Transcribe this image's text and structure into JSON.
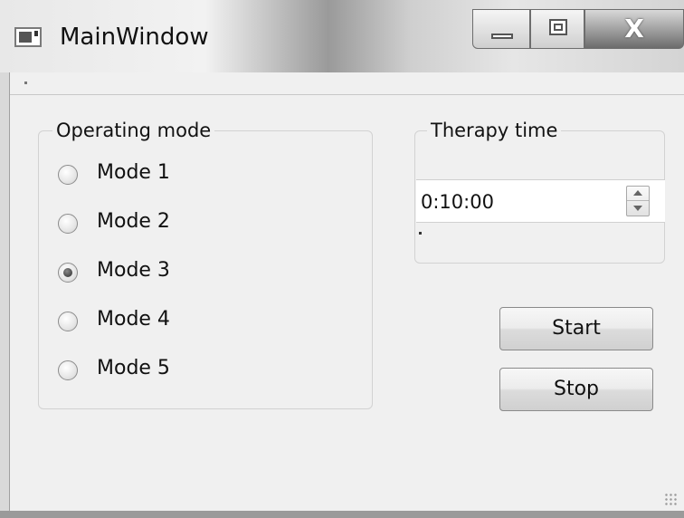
{
  "window": {
    "title": "MainWindow",
    "controls": {
      "minimize": "minimize",
      "maximize": "maximize",
      "close_glyph": "X"
    }
  },
  "operating_mode": {
    "title": "Operating mode",
    "options": [
      {
        "label": "Mode 1",
        "checked": false
      },
      {
        "label": "Mode 2",
        "checked": false
      },
      {
        "label": "Mode 3",
        "checked": true
      },
      {
        "label": "Mode 4",
        "checked": false
      },
      {
        "label": "Mode 5",
        "checked": false
      }
    ]
  },
  "therapy_time": {
    "title": "Therapy time",
    "value": "0:10:00"
  },
  "buttons": {
    "start": "Start",
    "stop": "Stop"
  }
}
